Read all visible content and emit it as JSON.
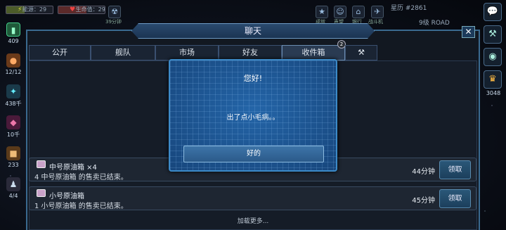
{
  "topbar": {
    "energy_label": "能源：29",
    "health_label": "生命值：29",
    "timer": "39分钟",
    "icons": [
      "star-icon",
      "face-icon",
      "bank-icon",
      "jet-icon"
    ],
    "icon_labels": [
      "成就",
      "声望",
      "银行",
      "战斗机"
    ],
    "starmap": "星历 #2861",
    "level": "9级 ROAD"
  },
  "left_sidebar": [
    {
      "icon": "battery-icon",
      "value": "409"
    },
    {
      "icon": "ore-icon",
      "value": "12/12"
    },
    {
      "icon": "crystal-icon",
      "value": "438千"
    },
    {
      "icon": "gem-icon",
      "value": "10千"
    },
    {
      "icon": "crate-icon",
      "value": "233"
    },
    {
      "icon": "people-icon",
      "value": "4/4"
    }
  ],
  "right_sidebar": {
    "value": "3048"
  },
  "chat": {
    "title": "聊天",
    "tabs": [
      {
        "label": "公开",
        "active": false
      },
      {
        "label": "舰队",
        "active": false
      },
      {
        "label": "市场",
        "active": false
      },
      {
        "label": "好友",
        "active": false
      },
      {
        "label": "收件箱",
        "active": true,
        "badge": "2"
      },
      {
        "label": "",
        "icon": "hammer-icon",
        "active": false
      }
    ],
    "mails": [
      {
        "title": "中号原油箱 ×4",
        "sub": "4 中号原油箱 的售卖已结束。",
        "time": "44分钟",
        "action": "领取"
      },
      {
        "title": "小号原油箱",
        "sub": "1 小号原油箱 的售卖已结束。",
        "time": "45分钟",
        "action": "领取"
      }
    ],
    "load_more": "加载更多..."
  },
  "dialog": {
    "title": "您好!",
    "message": "出了点小毛病。。",
    "ok": "好的"
  },
  "colors": {
    "dialog_bg": "#1a4f8c",
    "frame_border": "#3a6a90",
    "accent": "#3c8ac8"
  }
}
